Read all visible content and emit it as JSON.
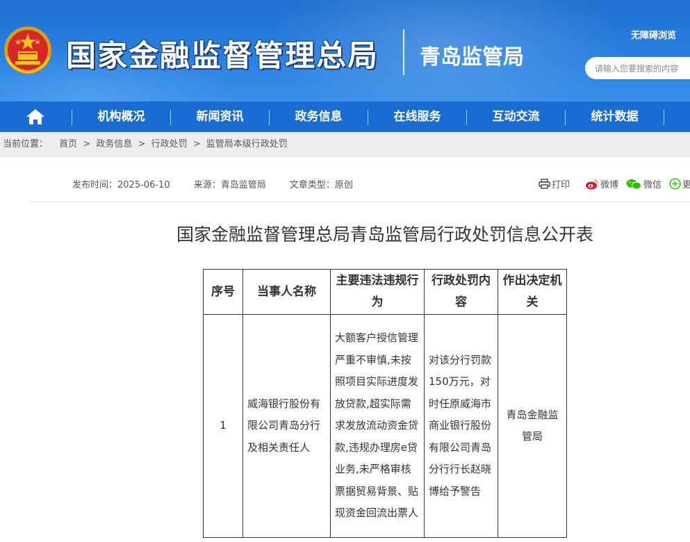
{
  "header": {
    "site_title": "国家金融监督管理总局",
    "sub_title": "青岛监管局",
    "accessibility": "无障碍浏览",
    "search_placeholder": "请输入您要搜索的内容"
  },
  "nav": {
    "items": [
      "机构概况",
      "新闻资讯",
      "政务信息",
      "在线服务",
      "互动交流",
      "统计数据"
    ]
  },
  "breadcrumb": {
    "label": "当前位置：",
    "items": [
      "首页",
      "政务信息",
      "行政处罚",
      "监管局本级行政处罚"
    ],
    "separator": ">"
  },
  "meta": {
    "publish_label": "发布时间：",
    "publish_date": "2025-06-10",
    "source_label": "来源：",
    "source": "青岛监管局",
    "type_label": "文章类型：",
    "type": "原创"
  },
  "share": {
    "print": "打印",
    "weibo": "微博",
    "wechat": "微信",
    "more": "更"
  },
  "article": {
    "title": "国家金融监督管理总局青岛监管局行政处罚信息公开表"
  },
  "table": {
    "headers": [
      "序号",
      "当事人名称",
      "主要违法违规行为",
      "行政处罚内容",
      "作出决定机关"
    ],
    "rows": [
      {
        "no": "1",
        "party": "威海银行股份有限公司青岛分行及相关责任人",
        "violation": "大额客户授信管理严重不审慎,未按照项目实际进度发放贷款,超实际需求发放流动资金贷款,违规办理房e贷业务,未严格审核票据贸易背景、贴现资金回流出票人",
        "penalty": "对该分行罚款150万元，对时任原威海市商业银行股份有限公司青岛分行行长赵晓博给予警告",
        "authority": "青岛金融监管局"
      }
    ]
  },
  "colors": {
    "header_blue": "#2a80e0",
    "nav_blue": "#1b6cd2",
    "breadcrumb_bg": "#eeeeee"
  }
}
